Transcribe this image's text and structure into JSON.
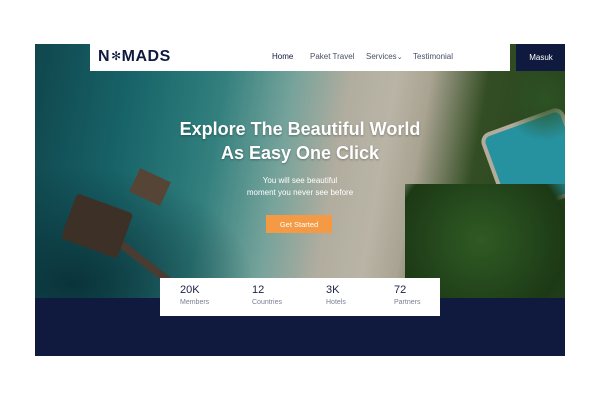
{
  "brand": {
    "logo_text": "NMADS",
    "logo_star": "✻"
  },
  "nav": {
    "items": [
      {
        "label": "Home"
      },
      {
        "label": "Paket Travel"
      },
      {
        "label": "Services"
      },
      {
        "label": "Testimonial"
      }
    ],
    "services_caret": "⌄",
    "login_label": "Masuk"
  },
  "hero": {
    "headline_line1": "Explore The Beautiful World",
    "headline_line2": "As Easy One Click",
    "sub_line1": "You will see beautiful",
    "sub_line2": "moment you never see before",
    "cta_label": "Get Started"
  },
  "stats": [
    {
      "value": "20K",
      "label": "Members"
    },
    {
      "value": "12",
      "label": "Countries"
    },
    {
      "value": "3K",
      "label": "Hotels"
    },
    {
      "value": "72",
      "label": "Partners"
    }
  ],
  "colors": {
    "navy": "#0f1a3e",
    "accent": "#f49a44"
  }
}
